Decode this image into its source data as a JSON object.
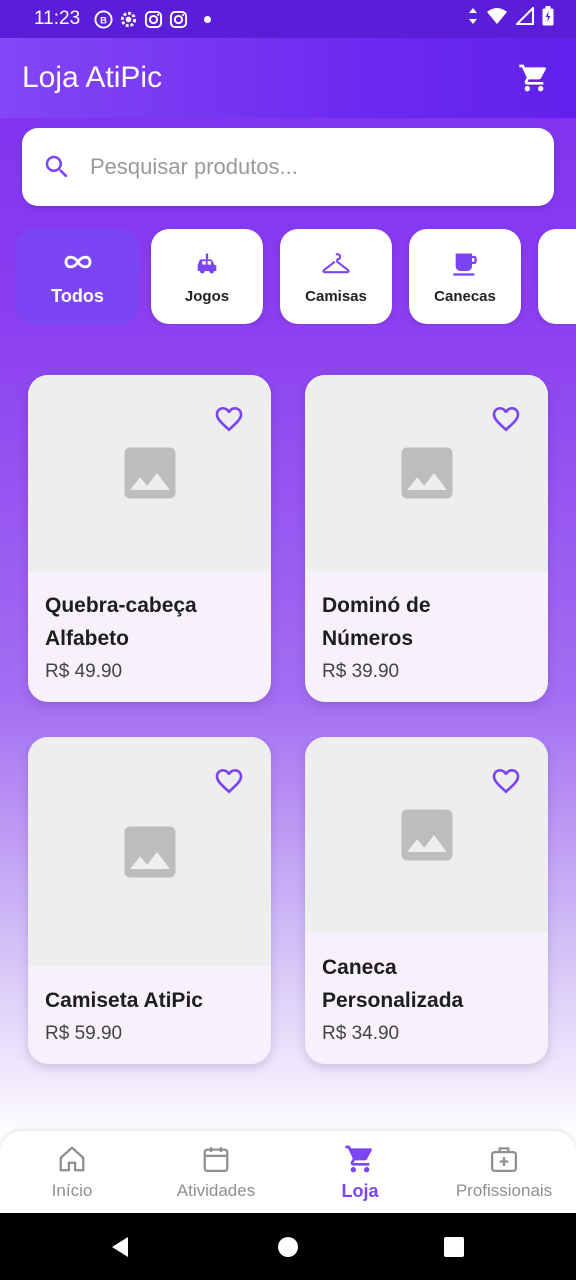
{
  "status_bar": {
    "time": "11:23"
  },
  "app_bar": {
    "title": "Loja AtiPic"
  },
  "search": {
    "placeholder": "Pesquisar produtos..."
  },
  "categories": [
    {
      "label": "Todos",
      "icon": "infinity-icon",
      "active": true
    },
    {
      "label": "Jogos",
      "icon": "toy-car-icon",
      "active": false
    },
    {
      "label": "Camisas",
      "icon": "hanger-icon",
      "active": false
    },
    {
      "label": "Canecas",
      "icon": "mug-icon",
      "active": false
    }
  ],
  "products": [
    {
      "name_line1": "Quebra-cabeça",
      "name_line2": "Alfabeto",
      "price": "R$ 49.90"
    },
    {
      "name_line1": "Dominó de",
      "name_line2": "Números",
      "price": "R$ 39.90"
    },
    {
      "name_line1": "Camiseta AtiPic",
      "name_line2": "",
      "price": "R$ 59.90"
    },
    {
      "name_line1": "Caneca",
      "name_line2": "Personalizada",
      "price": "R$ 34.90"
    }
  ],
  "bottom_nav": [
    {
      "label": "Início",
      "icon": "home-icon",
      "active": false
    },
    {
      "label": "Atividades",
      "icon": "calendar-icon",
      "active": false
    },
    {
      "label": "Loja",
      "icon": "cart-icon",
      "active": true
    },
    {
      "label": "Profissionais",
      "icon": "medical-kit-icon",
      "active": false
    }
  ],
  "colors": {
    "primary": "#7b45f4",
    "app_bar": "#6f2af0",
    "status_bar": "#5b1ed8"
  }
}
